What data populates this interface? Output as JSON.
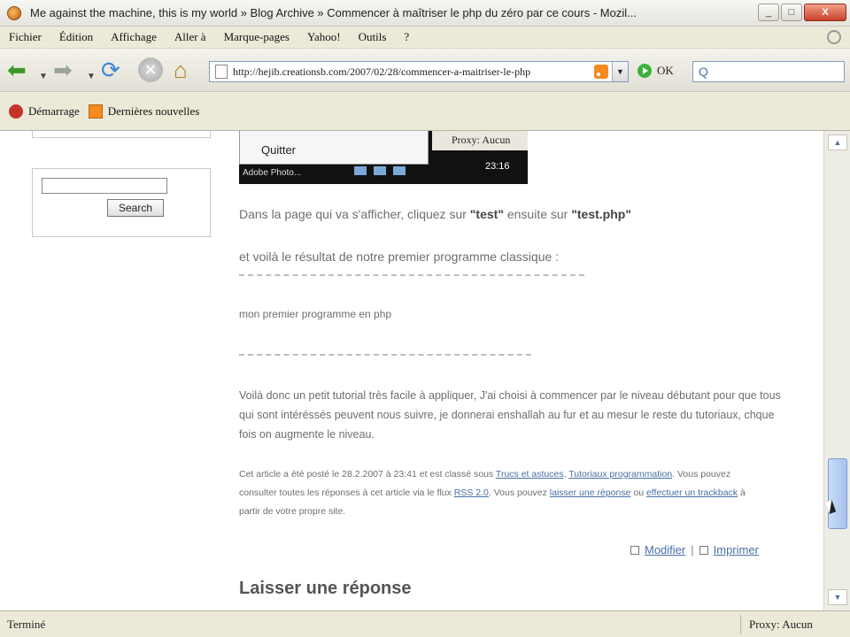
{
  "window": {
    "title": "Me against the machine, this is my world » Blog Archive » Commencer à maîtriser le php du zéro par ce cours - Mozil...",
    "minimize": "_",
    "maximize": "□",
    "close": "X"
  },
  "menu": [
    "Fichier",
    "Édition",
    "Affichage",
    "Aller à",
    "Marque-pages",
    "Yahoo!",
    "Outils",
    "?"
  ],
  "toolbar": {
    "url": "http://hejib.creationsb.com/2007/02/28/commencer-a-maitriser-le-php",
    "go_label": "OK"
  },
  "bookmarks": [
    "Démarrage",
    "Dernières nouvelles"
  ],
  "sidebar": {
    "search_button": "Search"
  },
  "embedded_screenshot": {
    "menu_item": "Quitter",
    "taskbar_item": "Adobe Photo...",
    "proxy": "Proxy: Aucun",
    "clock": "23:16"
  },
  "article": {
    "p1_a": "Dans la page qui va s'afficher, cliquez sur ",
    "p1_b": "\"test\"",
    "p1_c": " ensuite sur ",
    "p1_d": "\"test.php\"",
    "p2": "et voilà le résultat de notre premier programme classique :",
    "output": "mon premier programme en php",
    "p4": "Voilà donc un petit tutorial très facile à appliquer, J'ai choisi à commencer par le niveau débutant pour que tous qui sont intéréssés peuvent nous suivre, je donnerai enshallah au fur et au mesur le reste du tutoriaux, chque fois on augmente le niveau.",
    "meta_1": "Cet article a été posté le 28.2.2007 à 23:41 et est classé sous ",
    "meta_link_1": "Trucs et astuces",
    "meta_sep": ", ",
    "meta_link_2": "Tutoriaux programmation",
    "meta_2": ". Vous pouvez consulter toutes les réponses à cet article via le flux ",
    "meta_link_3": "RSS 2.0",
    "meta_3": ". Vous pouvez ",
    "meta_link_4": "laisser une réponse",
    "meta_4": " ou ",
    "meta_link_5": "effectuer un trackback",
    "meta_5": " à partir de votre propre site.",
    "edit": "Modifier",
    "edit_sep": "|",
    "print": "Imprimer",
    "reply_heading": "Laisser une réponse"
  },
  "status": {
    "left": "Terminé",
    "right": "Proxy: Aucun"
  }
}
